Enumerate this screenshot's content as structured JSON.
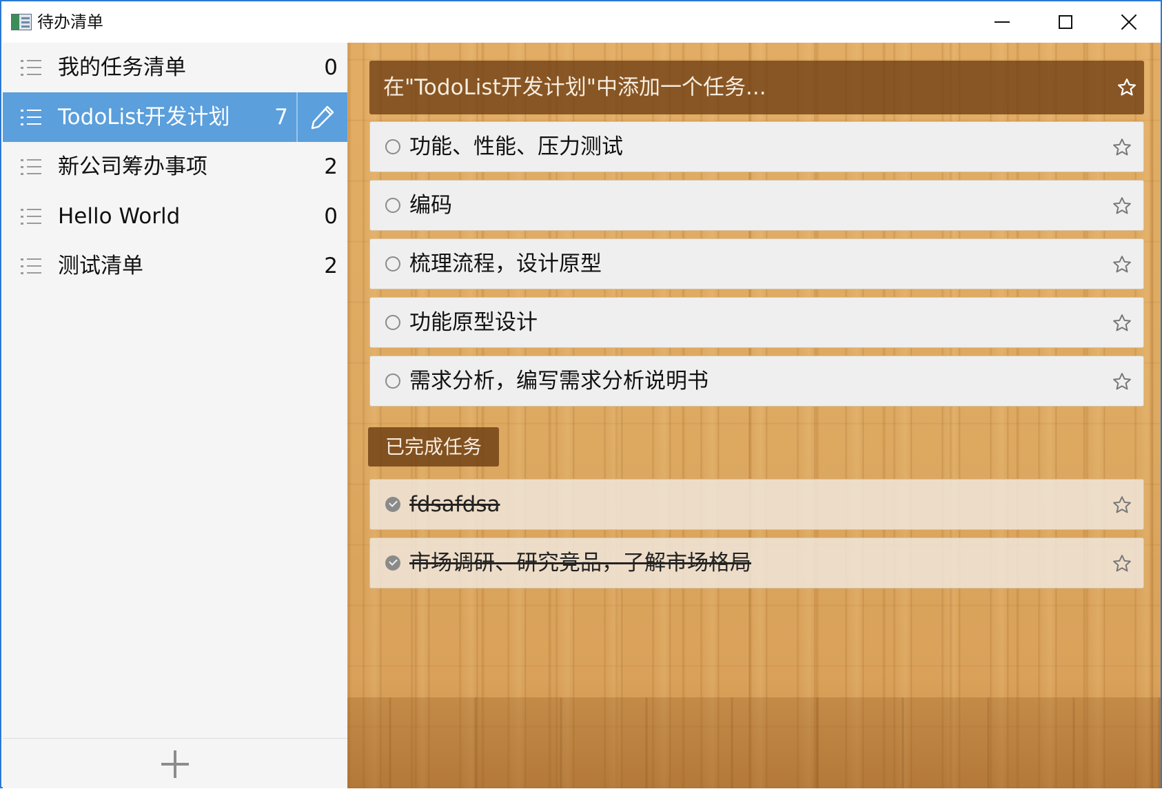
{
  "window": {
    "title": "待办清单",
    "minimize": "minimize",
    "maximize": "maximize",
    "close": "close"
  },
  "sidebar": {
    "items": [
      {
        "label": "我的任务清单",
        "count": "0",
        "icon": "list-icon",
        "active": false
      },
      {
        "label": "TodoList开发计划",
        "count": "7",
        "icon": "list-icon",
        "active": true
      },
      {
        "label": "新公司筹办事项",
        "count": "2",
        "icon": "list-icon",
        "active": false
      },
      {
        "label": "Hello World",
        "count": "0",
        "icon": "list-icon",
        "active": false
      },
      {
        "label": "测试清单",
        "count": "2",
        "icon": "list-icon",
        "active": false
      }
    ],
    "edit_icon": "pencil-icon",
    "add_icon": "plus-icon",
    "active_color": "#5b9fdc"
  },
  "main": {
    "add_task_placeholder": "在\"TodoList开发计划\"中添加一个任务...",
    "pending_tasks": [
      {
        "title": "功能、性能、压力测试",
        "starred": false
      },
      {
        "title": "编码",
        "starred": false
      },
      {
        "title": "梳理流程，设计原型",
        "starred": false
      },
      {
        "title": "功能原型设计",
        "starred": false
      },
      {
        "title": "需求分析，编写需求分析说明书",
        "starred": false
      }
    ],
    "completed_label": "已完成任务",
    "completed_tasks": [
      {
        "title": "fdsafdsa",
        "starred": false
      },
      {
        "title": "市场调研、研究竞品，了解市场格局",
        "starred": false
      }
    ]
  }
}
